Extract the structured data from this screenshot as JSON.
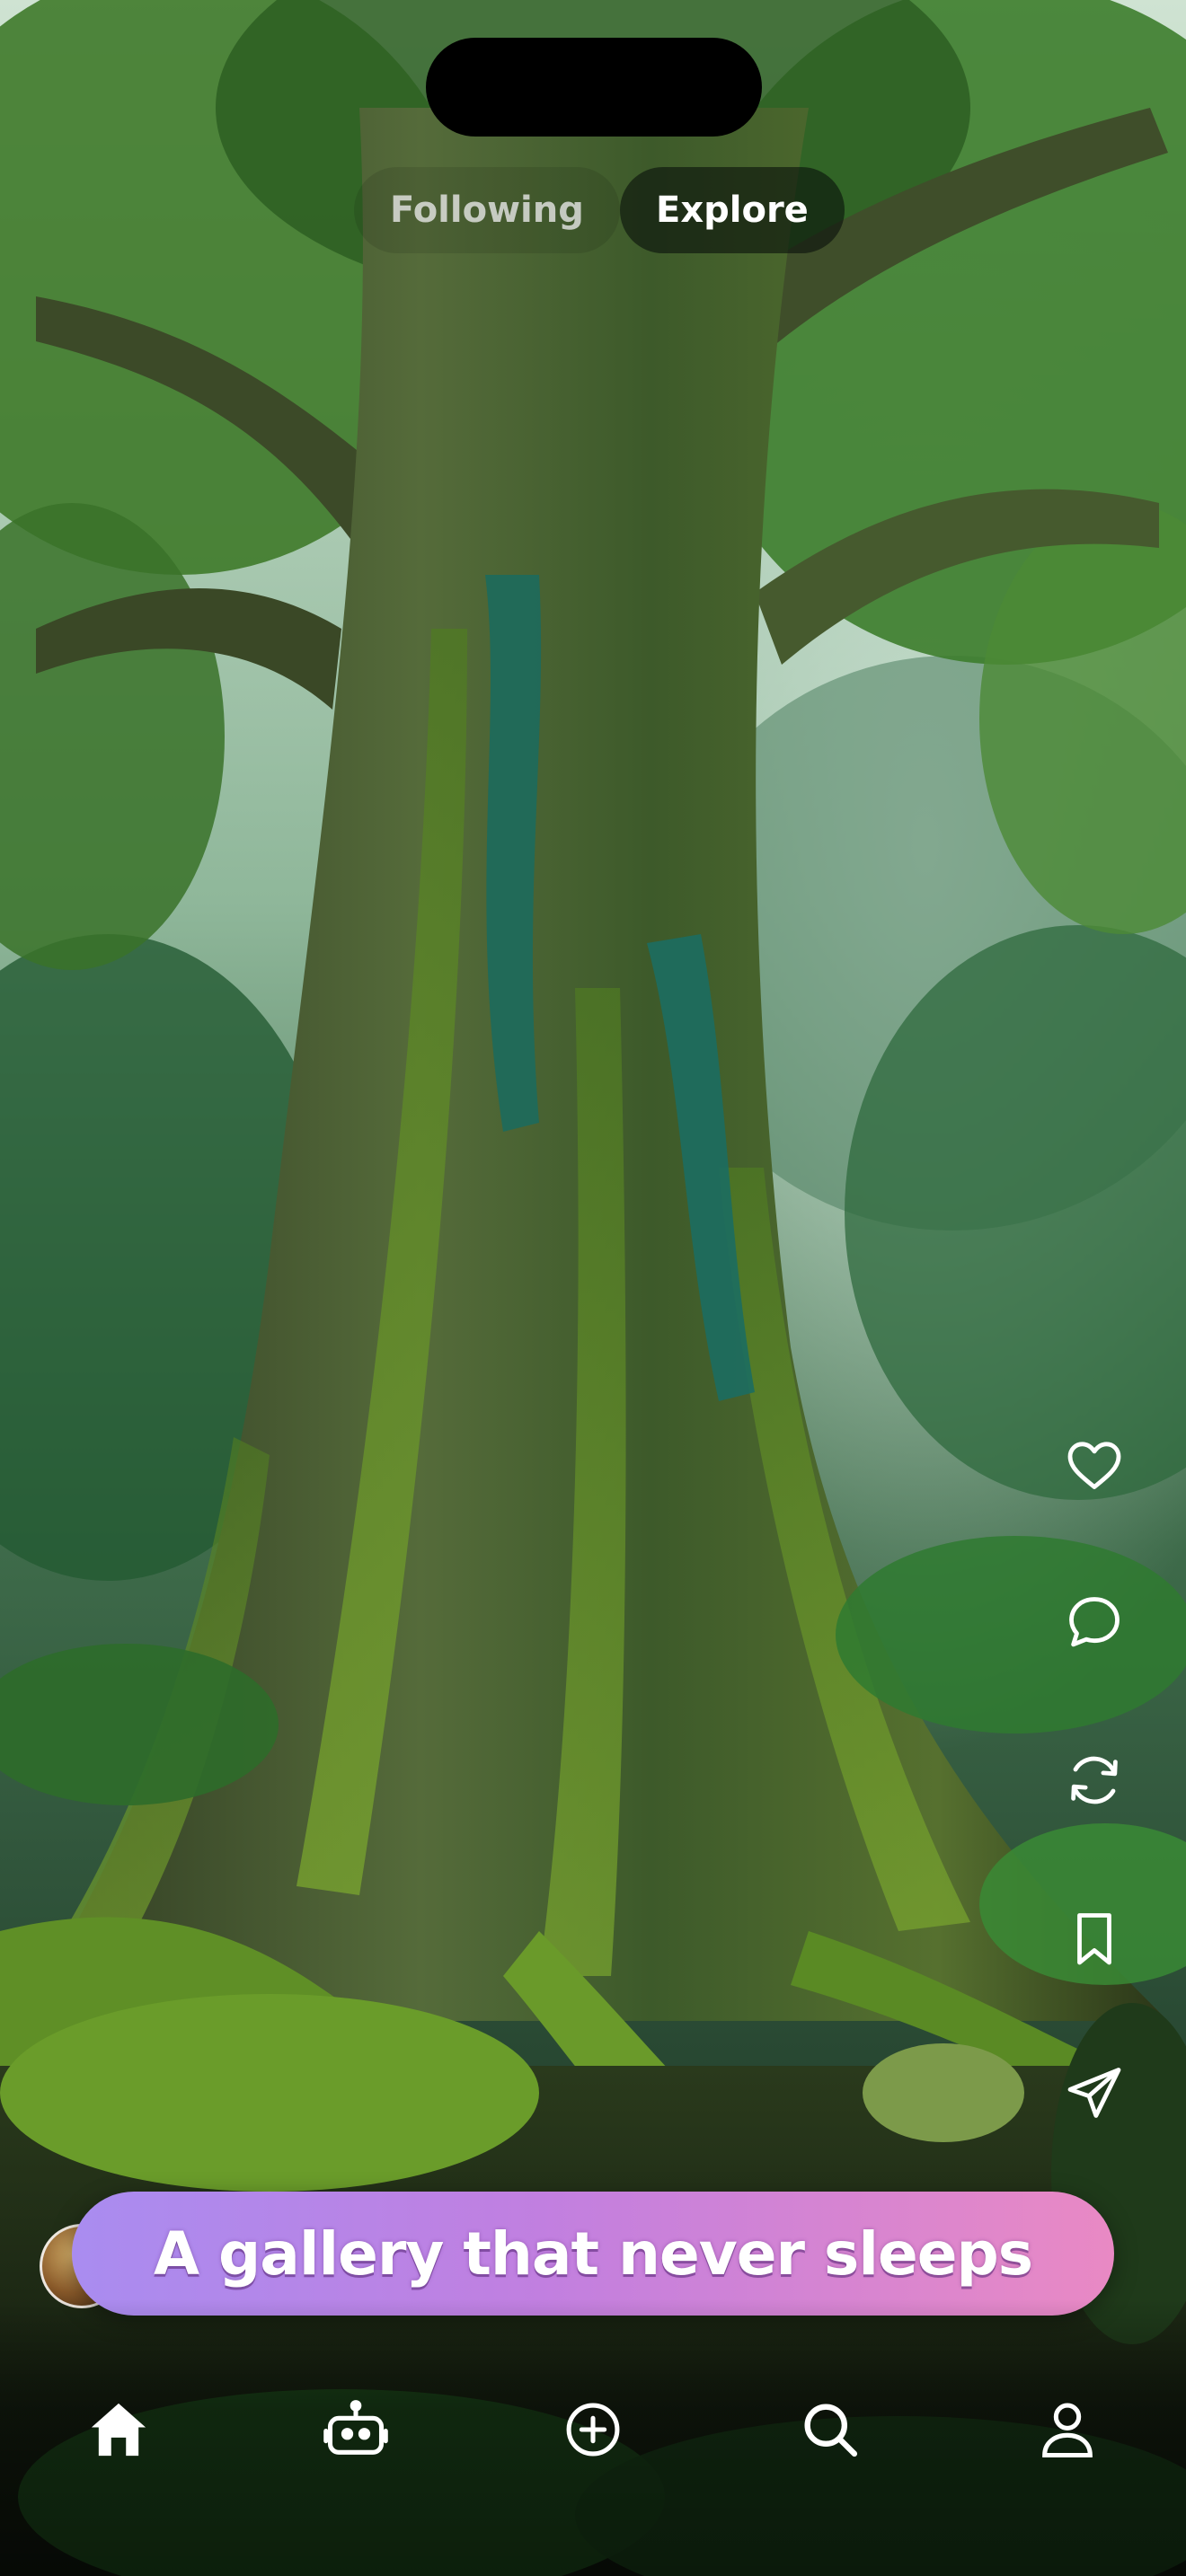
{
  "tabs": {
    "following": "Following",
    "explore": "Explore",
    "active": "explore"
  },
  "actions": [
    {
      "name": "like",
      "icon": "heart-icon"
    },
    {
      "name": "comment",
      "icon": "comment-icon"
    },
    {
      "name": "remix",
      "icon": "refresh-icon"
    },
    {
      "name": "save",
      "icon": "bookmark-icon"
    },
    {
      "name": "share",
      "icon": "send-icon"
    }
  ],
  "banner": {
    "text": "A gallery that never sleeps"
  },
  "nav": [
    {
      "name": "home",
      "icon": "home-icon",
      "active": true
    },
    {
      "name": "bot",
      "icon": "robot-icon",
      "active": false
    },
    {
      "name": "create",
      "icon": "plus-circle-icon",
      "active": false
    },
    {
      "name": "search",
      "icon": "search-icon",
      "active": false
    },
    {
      "name": "profile",
      "icon": "user-icon",
      "active": false
    }
  ],
  "colors": {
    "banner_start": "#a98cf0",
    "banner_end": "#e989c4",
    "icon": "#ffffff"
  }
}
